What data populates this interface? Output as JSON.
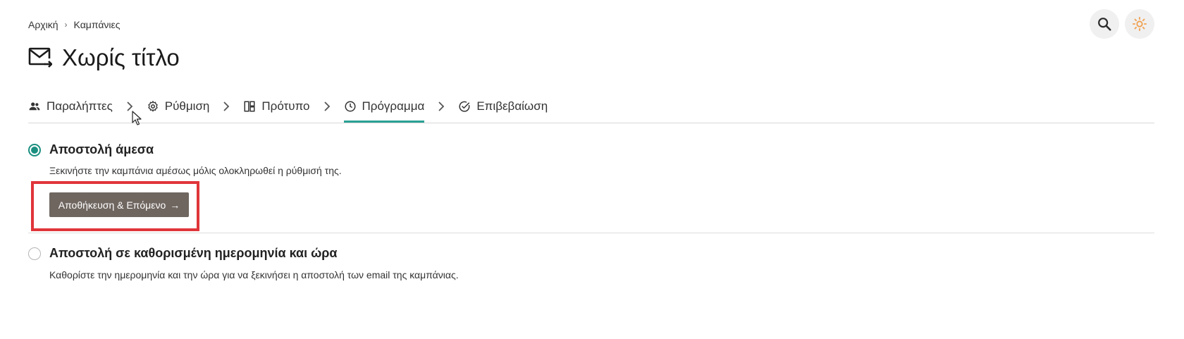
{
  "breadcrumb": {
    "home": "Αρχική",
    "separator": "›",
    "current": "Καμπάνιες"
  },
  "header": {
    "title": "Χωρίς τίτλο",
    "icon": "mail-send-icon"
  },
  "top_actions": {
    "search_icon": "search-icon",
    "theme_icon": "sun-icon",
    "theme_icon_color": "#f0a050"
  },
  "steps": [
    {
      "label": "Παραλήπτες",
      "icon": "users-icon"
    },
    {
      "label": "Ρύθμιση",
      "icon": "gear-icon"
    },
    {
      "label": "Πρότυπο",
      "icon": "template-icon"
    },
    {
      "label": "Πρόγραμμα",
      "icon": "clock-icon",
      "active": true
    },
    {
      "label": "Επιβεβαίωση",
      "icon": "check-circle-icon"
    }
  ],
  "options": {
    "immediate": {
      "title": "Αποστολή άμεσα",
      "description": "Ξεκινήστε την καμπάνια αμέσως μόλις ολοκληρωθεί η ρύθμισή της.",
      "selected": true
    },
    "scheduled": {
      "title": "Αποστολή σε καθορισμένη ημερομηνία και ώρα",
      "description": "Καθορίστε την ημερομηνία και την ώρα για να ξεκινήσει η αποστολή των email της καμπάνιας.",
      "selected": false
    }
  },
  "save_button": {
    "label": "Αποθήκευση & Επόμενο",
    "arrow": "→"
  },
  "colors": {
    "accent": "#2aa095",
    "radio": "#1b8f80",
    "button_bg": "#6f6660",
    "highlight": "#e0353a"
  }
}
